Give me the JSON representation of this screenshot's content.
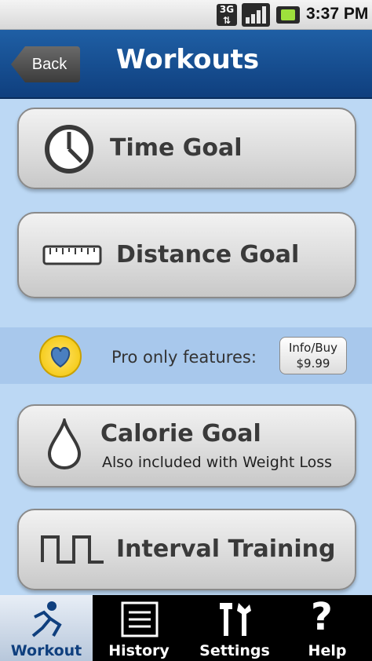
{
  "status_bar": {
    "network": "3G",
    "time": "3:37 PM"
  },
  "header": {
    "back_label": "Back",
    "title": "Workouts"
  },
  "buttons": {
    "time_goal": "Time Goal",
    "distance_goal": "Distance Goal",
    "calorie_goal": "Calorie Goal",
    "calorie_sub": "Also included with Weight Loss",
    "interval_training": "Interval Training"
  },
  "pro": {
    "text": "Pro only features:",
    "info_line1": "Info/Buy",
    "info_line2": "$9.99"
  },
  "tabs": [
    {
      "label": "Workout",
      "icon": "runner-icon",
      "active": true
    },
    {
      "label": "History",
      "icon": "list-icon",
      "active": false
    },
    {
      "label": "Settings",
      "icon": "tools-icon",
      "active": false
    },
    {
      "label": "Help",
      "icon": "question-icon",
      "active": false
    }
  ],
  "colors": {
    "header": "#1f5fa5",
    "background": "#bcd8f4",
    "pro_band": "#a8c8ec",
    "heart": "#f2c400"
  }
}
